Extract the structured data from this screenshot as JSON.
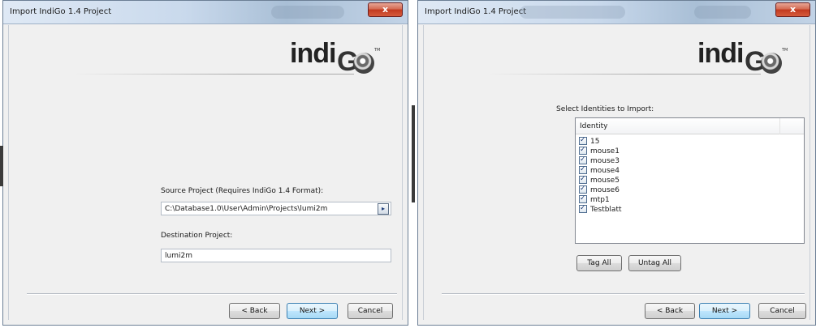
{
  "left_window": {
    "title": "Import IndiGo 1.4 Project",
    "close_glyph": "x",
    "logo_text": "indi",
    "logo_g": "G",
    "logo_tm": "TM",
    "source_label": "Source Project (Requires IndiGo 1.4 Format):",
    "source_value": "C:\\Database1.0\\User\\Admin\\Projects\\lumi2m",
    "browse_glyph": "▸",
    "dest_label": "Destination Project:",
    "dest_value": "lumi2m",
    "buttons": {
      "back": "< Back",
      "next": "Next >",
      "cancel": "Cancel"
    }
  },
  "right_window": {
    "title": "Import IndiGo 1.4 Project",
    "close_glyph": "x",
    "logo_text": "indi",
    "logo_g": "G",
    "logo_tm": "TM",
    "select_label": "Select Identities to Import:",
    "list_header": "Identity",
    "identities": [
      "15",
      "mouse1",
      "mouse3",
      "mouse4",
      "mouse5",
      "mouse6",
      "mtp1",
      "Testblatt"
    ],
    "tag_all": "Tag All",
    "untag_all": "Untag All",
    "buttons": {
      "back": "< Back",
      "next": "Next >",
      "cancel": "Cancel"
    }
  },
  "colors": {
    "titlebar": "#c9d9ec",
    "close": "#c2391f",
    "focus_button": "#a7d9f5",
    "dialog_bg": "#f0f0f0"
  },
  "icons": {
    "close": "close-icon",
    "browse": "browse-icon",
    "checkbox": "checkbox-checked-icon",
    "logo": "indigo-logo"
  }
}
